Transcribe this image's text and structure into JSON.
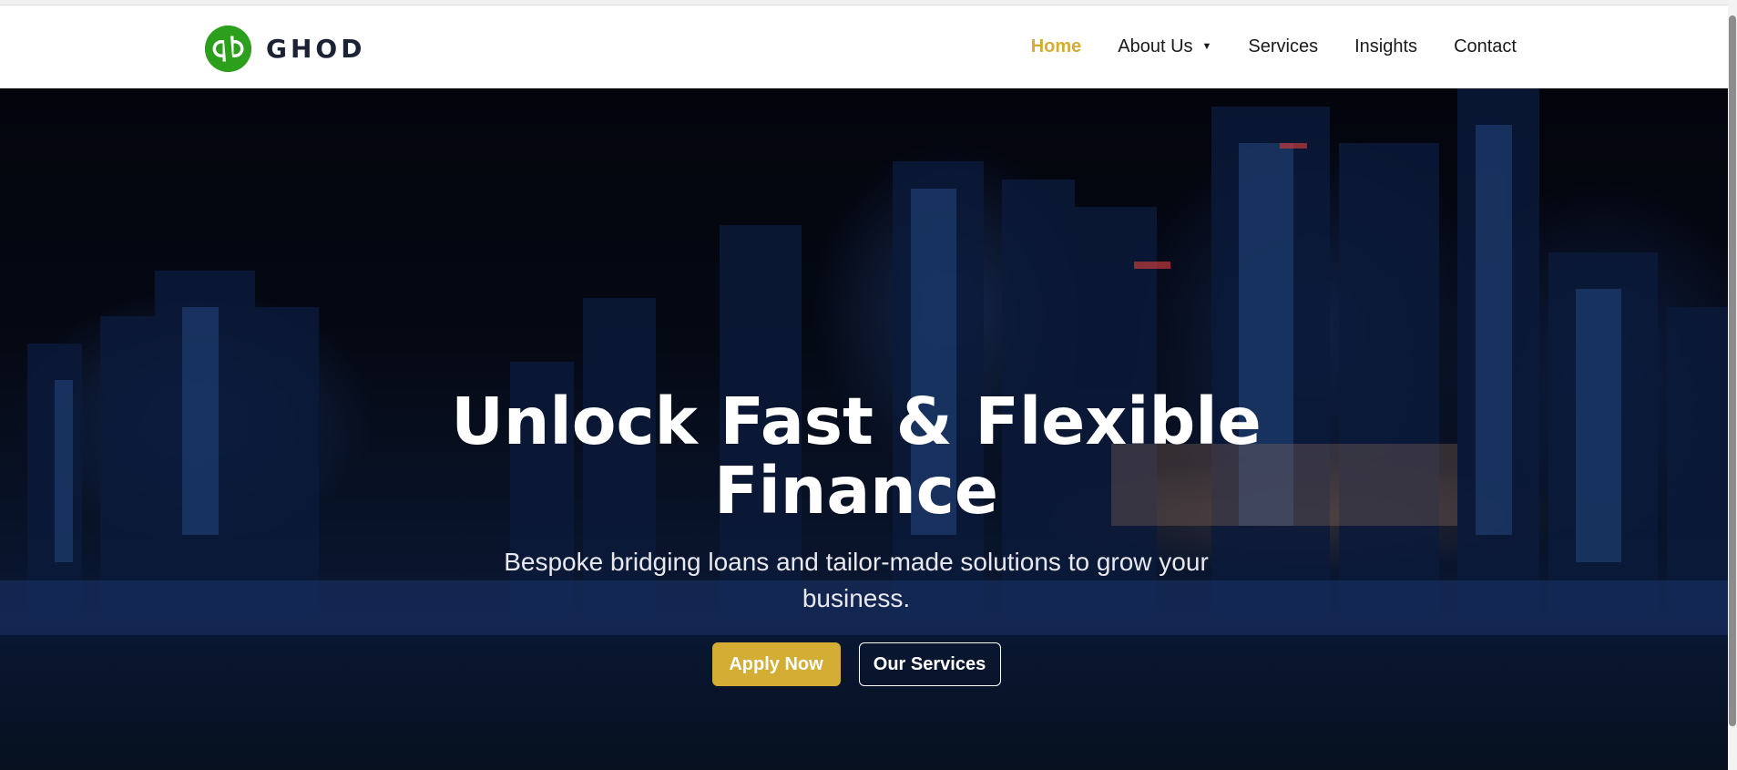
{
  "brand": {
    "name": "GHOD",
    "logo_icon": "qb-logo-icon",
    "logo_color": "#2ca01c"
  },
  "nav": {
    "items": [
      {
        "label": "Home",
        "active": true
      },
      {
        "label": "About Us",
        "has_dropdown": true
      },
      {
        "label": "Services"
      },
      {
        "label": "Insights"
      },
      {
        "label": "Contact"
      }
    ],
    "active_color": "#d4ad35"
  },
  "hero": {
    "title_line1": "Unlock Fast & Flexible",
    "title_line2": "Finance",
    "subtitle": "Bespoke bridging loans and tailor-made solutions to grow your business.",
    "primary_button": "Apply Now",
    "secondary_button": "Our Services",
    "background": "night-city-skyline"
  },
  "colors": {
    "accent": "#d4ad35",
    "header_bg": "#ffffff",
    "hero_text": "#ffffff"
  }
}
